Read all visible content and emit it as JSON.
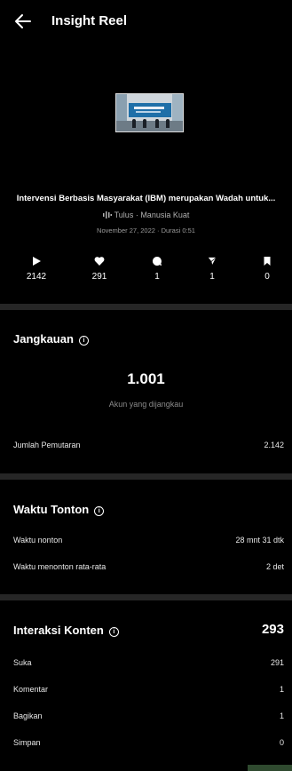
{
  "header": {
    "title": "Insight Reel",
    "back_icon": "arrow-left-icon"
  },
  "reel": {
    "title": "Intervensi Berbasis Masyarakat (IBM) merupakan Wadah untuk...",
    "audio": "Tulus · Manusia Kuat",
    "meta": "November 27, 2022 · Durasi 0:51"
  },
  "stats": {
    "plays": "2142",
    "likes": "291",
    "comments": "1",
    "shares": "1",
    "saves": "0"
  },
  "reach": {
    "title": "Jangkauan",
    "accounts_reached": "1.001",
    "accounts_caption": "Akun yang dijangkau",
    "plays_label": "Jumlah Pemutaran",
    "plays_value": "2.142"
  },
  "watch_time": {
    "title": "Waktu Tonton",
    "total_label": "Waktu nonton",
    "total_value": "28 mnt 31 dtk",
    "avg_label": "Waktu menonton rata-rata",
    "avg_value": "2 det"
  },
  "interactions": {
    "title": "Interaksi Konten",
    "total": "293",
    "likes_label": "Suka",
    "likes_value": "291",
    "comments_label": "Komentar",
    "comments_value": "1",
    "shares_label": "Bagikan",
    "shares_value": "1",
    "saves_label": "Simpan",
    "saves_value": "0"
  },
  "colors": {
    "background": "#000000",
    "divider": "#262626",
    "muted_text": "#8a8a8a"
  }
}
